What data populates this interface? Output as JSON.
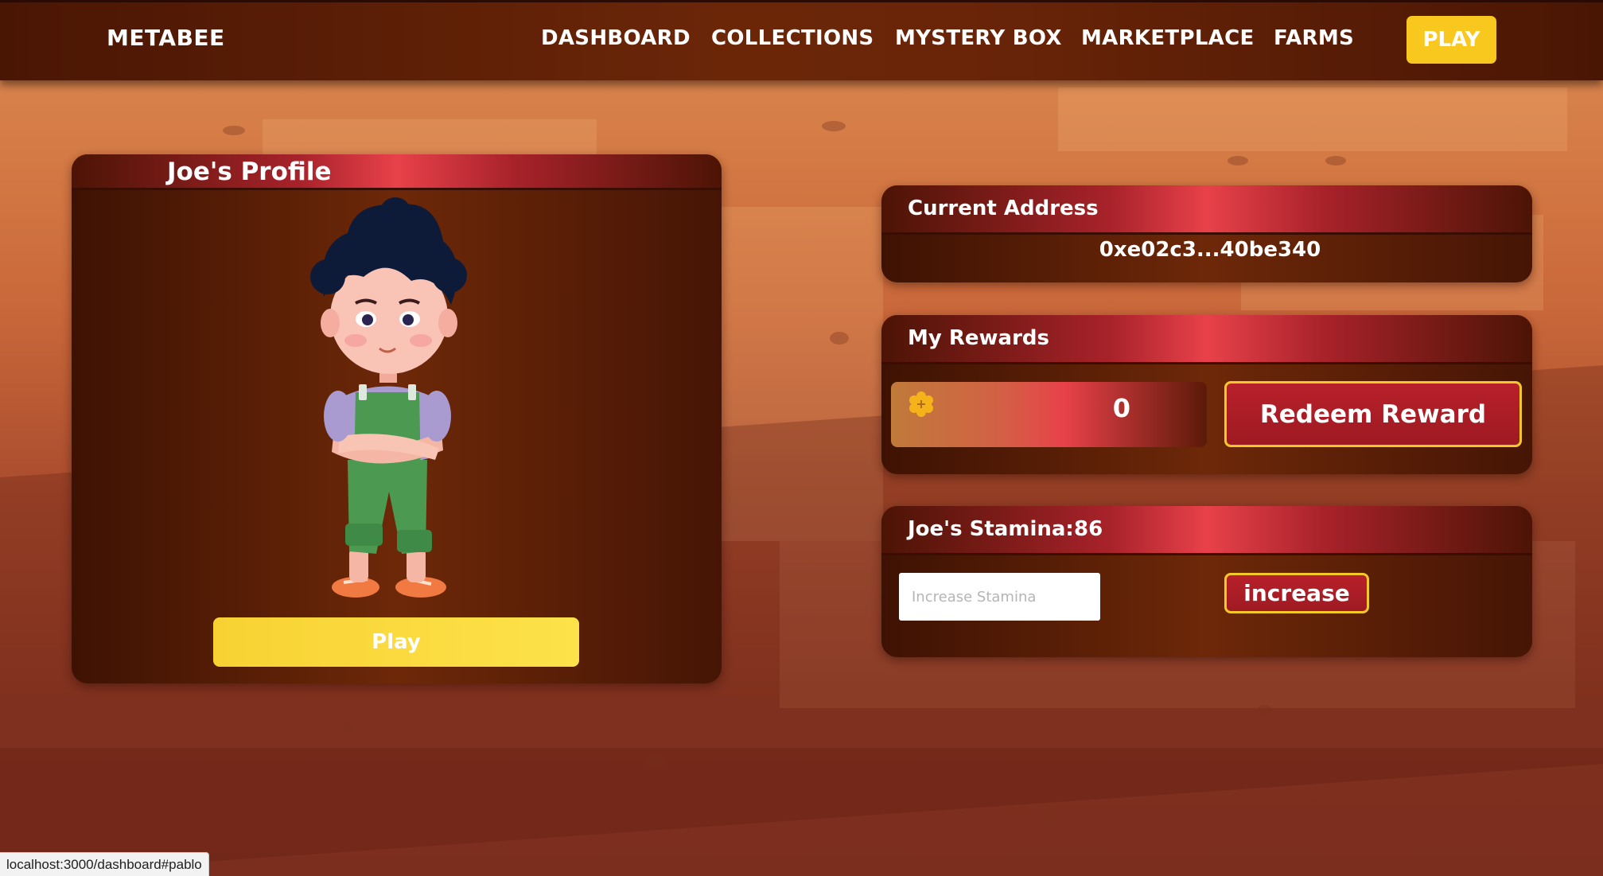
{
  "header": {
    "brand": "METABEE",
    "nav": [
      {
        "label": "DASHBOARD"
      },
      {
        "label": "COLLECTIONS"
      },
      {
        "label": "MYSTERY BOX"
      },
      {
        "label": "MARKETPLACE"
      },
      {
        "label": "FARMS"
      }
    ],
    "play_label": "PLAY"
  },
  "profile": {
    "title": "Joe's Profile",
    "play_label": "Play"
  },
  "address": {
    "title": "Current Address",
    "value": "0xe02c3...40be340"
  },
  "rewards": {
    "title": "My Rewards",
    "icon": "honey-icon",
    "amount": "0",
    "redeem_label": "Redeem Reward"
  },
  "stamina": {
    "title": "Joe's Stamina:",
    "value": "86",
    "input_placeholder": "Increase Stamina",
    "input_value": "",
    "button_label": "increase"
  },
  "status": {
    "url": "localhost:3000/dashboard#pablo"
  },
  "colors": {
    "accent_yellow": "#f8c81e",
    "header_brown": "#6b2608",
    "card_red": "#e8414a",
    "button_red": "#b8202a"
  }
}
